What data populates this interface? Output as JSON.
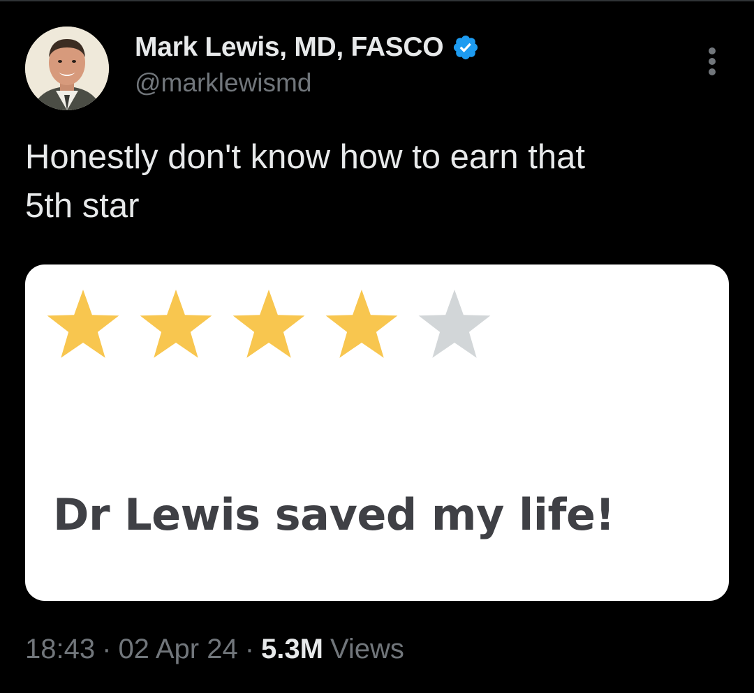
{
  "author": {
    "display_name": "Mark Lewis, MD, FASCO",
    "handle": "@marklewismd",
    "verified": true,
    "verified_color": "#1d9bf0"
  },
  "tweet": {
    "text": "Honestly don't know how to earn that\n5th star"
  },
  "media": {
    "rating": {
      "filled": 4,
      "total": 5
    },
    "filled_star_color": "#f8c64f",
    "empty_star_color": "#d2d6d8",
    "review_text": "Dr Lewis saved my life!"
  },
  "meta": {
    "time": "18:43",
    "separator": "·",
    "date": "02 Apr 24",
    "views_count": "5.3M",
    "views_label": "Views"
  },
  "icons": {
    "more": "more-vertical-icon",
    "verified": "verified-badge-icon"
  }
}
